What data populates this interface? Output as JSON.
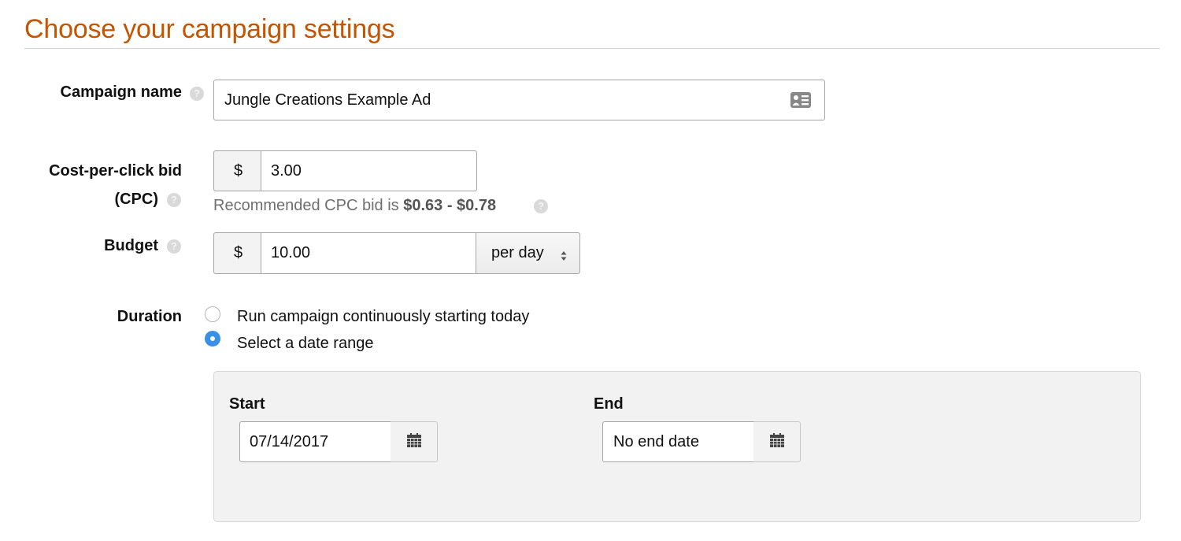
{
  "page": {
    "title": "Choose your campaign settings"
  },
  "campaign_name": {
    "label": "Campaign name",
    "help_icon": "question-circle-icon",
    "value": "Jungle Creations Example Ad",
    "field_icon": "contact-card-icon"
  },
  "cpc": {
    "label_line1": "Cost-per-click bid",
    "label_line2": "(CPC)",
    "help_icon": "question-circle-icon",
    "currency": "$",
    "value": "3.00",
    "recommended_prefix": "Recommended CPC bid is ",
    "recommended_range": "$0.63 - $0.78"
  },
  "budget": {
    "label": "Budget",
    "help_icon": "question-circle-icon",
    "currency": "$",
    "value": "10.00",
    "period_selected": "per day",
    "period_icon": "up-down-arrows-icon"
  },
  "duration": {
    "label": "Duration",
    "options": [
      {
        "label": "Run campaign continuously starting today",
        "checked": false
      },
      {
        "label": "Select a date range",
        "checked": true
      }
    ],
    "start": {
      "label": "Start",
      "value": "07/14/2017",
      "icon": "calendar-icon"
    },
    "end": {
      "label": "End",
      "value": "No end date",
      "icon": "calendar-icon"
    }
  },
  "colors": {
    "title": "#c45500",
    "radio_selected": "#3a8fe6",
    "panel_bg": "#f2f2f2"
  }
}
